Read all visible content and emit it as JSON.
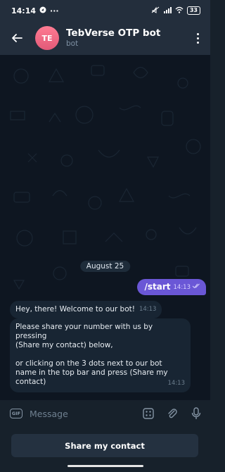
{
  "status_bar": {
    "time": "14:14",
    "extra": "···",
    "battery": "33"
  },
  "header": {
    "avatar_initials": "TE",
    "title": "TebVerse OTP bot",
    "subtitle": "bot"
  },
  "chat": {
    "date": "August 25",
    "outgoing": {
      "text": "/start",
      "time": "14:13"
    },
    "incoming": [
      {
        "text": "Hey, there! Welcome to our bot!",
        "time": "14:13"
      },
      {
        "para1": "Please share your number with us by pressing",
        "para2": "(Share my contact) below,",
        "para3": "or clicking on the 3 dots next to our bot name in the top bar and press (Share my contact)",
        "time": "14:13"
      }
    ]
  },
  "composer": {
    "gif_label": "GIF",
    "placeholder": "Message"
  },
  "reply_keyboard": {
    "button": "Share my contact"
  },
  "colors": {
    "outgoing_bubble": "#6a57d6",
    "incoming_bubble": "#182533",
    "header": "#232e3c"
  }
}
